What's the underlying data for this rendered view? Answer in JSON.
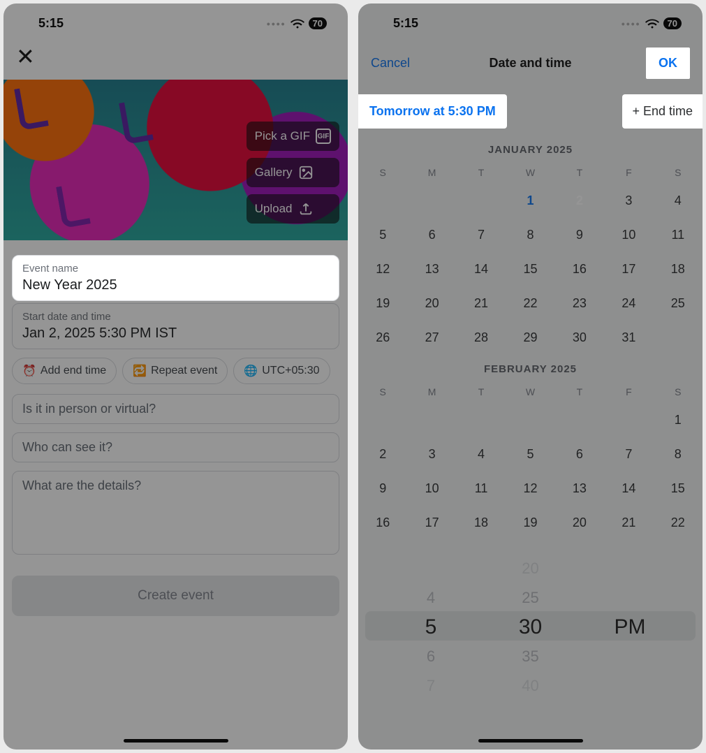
{
  "status": {
    "time": "5:15",
    "battery": "70"
  },
  "left": {
    "banner": {
      "pick_gif": "Pick a GIF",
      "gallery": "Gallery",
      "upload": "Upload"
    },
    "event_name_label": "Event name",
    "event_name_value": "New Year 2025",
    "start_label": "Start date and time",
    "start_value": "Jan 2, 2025 5:30 PM IST",
    "chips": {
      "add_end": "Add end time",
      "repeat": "Repeat event",
      "tz": "UTC+05:30"
    },
    "placeholders": {
      "location": "Is it in person or virtual?",
      "privacy": "Who can see it?",
      "details": "What are the details?"
    },
    "create": "Create event"
  },
  "right": {
    "nav": {
      "cancel": "Cancel",
      "title": "Date and time",
      "ok": "OK"
    },
    "start_pill": "Tomorrow at 5:30 PM",
    "end_pill": "+ End time",
    "dow": [
      "S",
      "M",
      "T",
      "W",
      "T",
      "F",
      "S"
    ],
    "months": [
      {
        "title": "JANUARY 2025",
        "lead_empty": 3,
        "today": 1,
        "selected": 2,
        "days": 31
      },
      {
        "title": "FEBRUARY 2025",
        "lead_empty": 6,
        "days_shown": 22
      }
    ],
    "picker": {
      "hour": [
        "",
        "4",
        "5",
        "6",
        "7"
      ],
      "minute": [
        "20",
        "25",
        "30",
        "35",
        "40"
      ],
      "ampm": [
        "",
        "",
        "PM",
        "",
        ""
      ]
    }
  }
}
